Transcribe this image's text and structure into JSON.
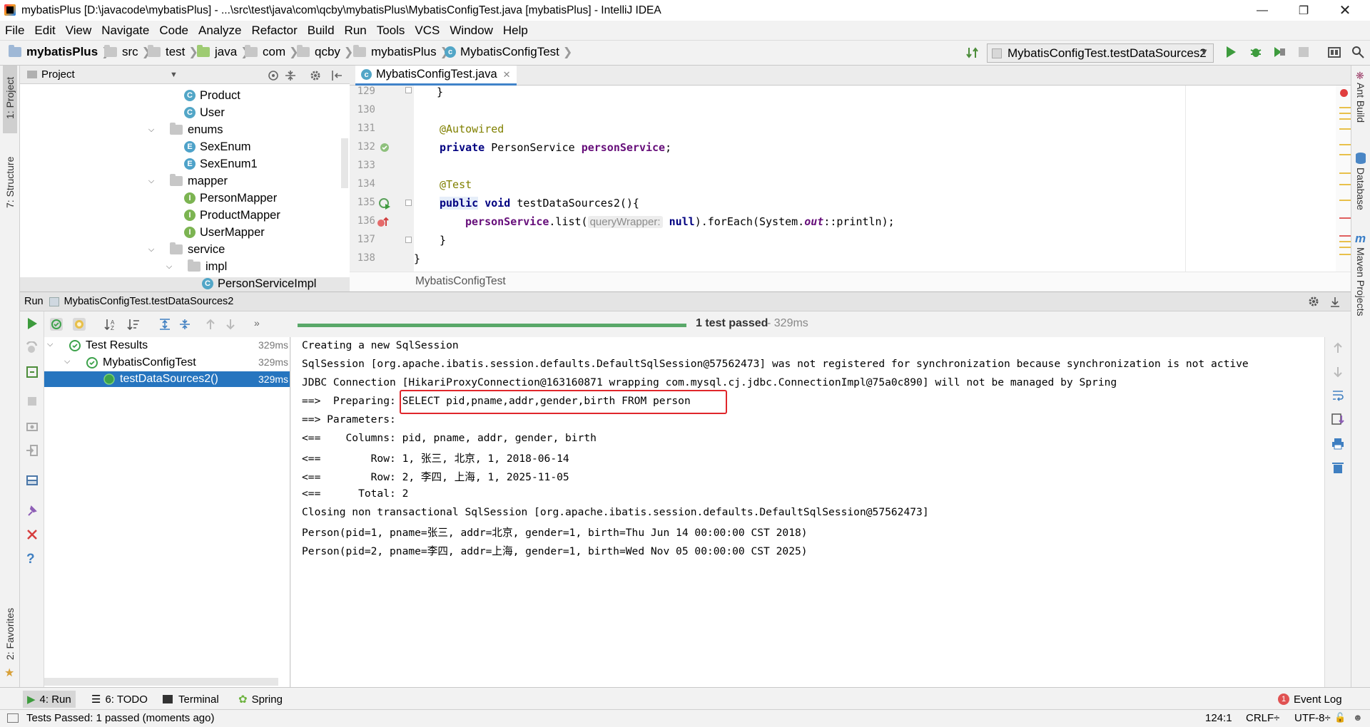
{
  "window": {
    "title": "mybatisPlus [D:\\javacode\\mybatisPlus] - ...\\src\\test\\java\\com\\qcby\\mybatisPlus\\MybatisConfigTest.java [mybatisPlus] - IntelliJ IDEA"
  },
  "menu": [
    "File",
    "Edit",
    "View",
    "Navigate",
    "Code",
    "Analyze",
    "Refactor",
    "Build",
    "Run",
    "Tools",
    "VCS",
    "Window",
    "Help"
  ],
  "breadcrumbs": [
    "mybatisPlus",
    "src",
    "test",
    "java",
    "com",
    "qcby",
    "mybatisPlus",
    "MybatisConfigTest"
  ],
  "run_config": "MybatisConfigTest.testDataSources2",
  "left_stripe": {
    "project": "1: Project",
    "structure": "7: Structure",
    "favorites": "2: Favorites"
  },
  "right_stripe": {
    "ant": "Ant Build",
    "database": "Database",
    "maven": "Maven Projects"
  },
  "project_panel": {
    "title": "Project",
    "tree": [
      {
        "label": "Product",
        "icon": "C",
        "indent": 3
      },
      {
        "label": "User",
        "icon": "C",
        "indent": 3
      },
      {
        "label": "enums",
        "icon": "folder",
        "indent": 2,
        "open": true
      },
      {
        "label": "SexEnum",
        "icon": "E",
        "indent": 3
      },
      {
        "label": "SexEnum1",
        "icon": "E",
        "indent": 3
      },
      {
        "label": "mapper",
        "icon": "folder",
        "indent": 2,
        "open": true
      },
      {
        "label": "PersonMapper",
        "icon": "I",
        "indent": 3
      },
      {
        "label": "ProductMapper",
        "icon": "I",
        "indent": 3
      },
      {
        "label": "UserMapper",
        "icon": "I",
        "indent": 3
      },
      {
        "label": "service",
        "icon": "folder",
        "indent": 2,
        "open": true
      },
      {
        "label": "impl",
        "icon": "folder",
        "indent": 3,
        "open": true
      },
      {
        "label": "PersonServiceImpl",
        "icon": "C",
        "indent": 4,
        "selected": true
      }
    ]
  },
  "editor": {
    "tab": "MybatisConfigTest.java",
    "footer": "MybatisConfigTest",
    "line_numbers": [
      "129",
      "130",
      "131",
      "132",
      "133",
      "134",
      "135",
      "136",
      "137",
      "138"
    ],
    "l129": "}",
    "l131_annotation": "@Autowired",
    "l132": {
      "kw": "private",
      "type": "PersonService",
      "field": "personService",
      "end": ";"
    },
    "l134_annotation": "@Test",
    "l135": {
      "kw1": "public",
      "kw2": "void",
      "rest": "testDataSources2(){"
    },
    "l136": {
      "field": "personService",
      "call": ".list(",
      "hint": "queryWrapper:",
      "kw": "null",
      "mid": ").forEach(System.",
      "it": "out",
      "end": "::println);"
    },
    "l137": "}",
    "l138": "}"
  },
  "run_panel": {
    "label": "Run",
    "config": "MybatisConfigTest.testDataSources2",
    "status": "1 test passed",
    "status_time": " - 329ms",
    "progress": 1.0,
    "tests": [
      {
        "label": "Test Results",
        "time": "329ms",
        "indent": 0
      },
      {
        "label": "MybatisConfigTest",
        "time": "329ms",
        "indent": 1
      },
      {
        "label": "testDataSources2()",
        "time": "329ms",
        "indent": 2,
        "selected": true
      }
    ],
    "console": [
      "Creating a new SqlSession",
      "SqlSession [org.apache.ibatis.session.defaults.DefaultSqlSession@57562473] was not registered for synchronization because synchronization is not active",
      "JDBC Connection [HikariProxyConnection@163160871 wrapping com.mysql.cj.jdbc.ConnectionImpl@75a0c890] will not be managed by Spring",
      "==>  Preparing: SELECT pid,pname,addr,gender,birth FROM person",
      "==> Parameters: ",
      "<==    Columns: pid, pname, addr, gender, birth",
      "<==        Row: 1, 张三, 北京, 1, 2018-06-14",
      "<==        Row: 2, 李四, 上海, 1, 2025-11-05",
      "<==      Total: 2",
      "Closing non transactional SqlSession [org.apache.ibatis.session.defaults.DefaultSqlSession@57562473]",
      "Person(pid=1, pname=张三, addr=北京, gender=1, birth=Thu Jun 14 00:00:00 CST 2018)",
      "Person(pid=2, pname=李四, addr=上海, gender=1, birth=Wed Nov 05 00:00:00 CST 2025)"
    ]
  },
  "bottom_tabs": {
    "run": "4: Run",
    "todo": "6: TODO",
    "terminal": "Terminal",
    "spring": "Spring",
    "event_log": "Event Log",
    "event_count": "1"
  },
  "status_bar": {
    "message": "Tests Passed: 1 passed (moments ago)",
    "position": "124:1",
    "line_sep": "CRLF÷",
    "encoding": "UTF-8÷"
  },
  "colors": {
    "accent": "#4083c9",
    "pass_green": "#3da24b",
    "progress": "#59a869",
    "selection": "#2675bf",
    "highlight_box": "#e0262b"
  }
}
